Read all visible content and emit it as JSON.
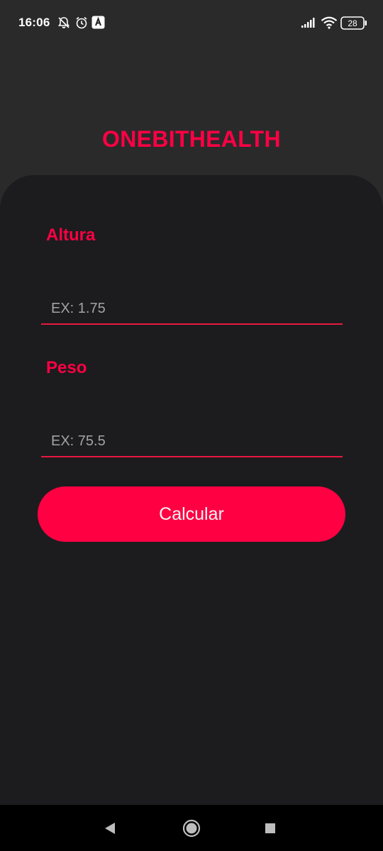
{
  "status_bar": {
    "time": "16:06",
    "battery_level": "28",
    "icons": [
      "notifications-off-icon",
      "alarm-icon",
      "app-notification-icon",
      "signal-icon",
      "wifi-icon",
      "battery-icon"
    ]
  },
  "app": {
    "title": "ONEBITHEALTH"
  },
  "form": {
    "height_label": "Altura",
    "height_placeholder": "EX: 1.75",
    "weight_label": "Peso",
    "weight_placeholder": "EX: 75.5",
    "calculate_label": "Calcular"
  },
  "nav_bar": {
    "buttons": [
      "back-button",
      "home-button",
      "recents-button"
    ]
  },
  "colors": {
    "accent": "#ff0043",
    "background_top": "#2a2a2b",
    "panel": "#1c1c1e",
    "nav_bar": "#000000",
    "placeholder_text": "#a3a3a3"
  }
}
